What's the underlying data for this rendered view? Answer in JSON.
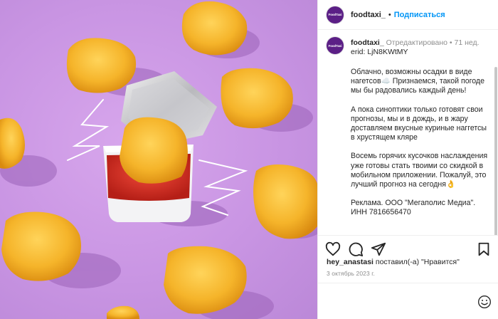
{
  "post": {
    "author": {
      "username": "foodtaxi_",
      "avatar_text": "FoodTaxi"
    },
    "header": {
      "separator": "•",
      "follow_label": "Подписаться"
    },
    "caption": {
      "edited_label": "Отредактировано",
      "dot": "•",
      "age": "71 нед.",
      "erid": "erid: LjN8KWtMY",
      "paragraphs": [
        "Облачно, возможны осадки в виде нагетсов☁️ Признаемся, такой погоде мы бы радовались каждый день!",
        "А пока синоптики только готовят свои прогнозы, мы и в дождь, и в жару доставляем вкусные куриные наггетсы в хрустящем кляре",
        "Восемь горячих кусочков наслаждения уже готовы стать твоими со скидкой в мобильном приложении. Пожалуй, это лучший прогноз на сегодня👌",
        "Реклама. ООО \"Мегаполис Медиа\". ИНН 7816656470"
      ]
    },
    "likes": {
      "user": "hey_anastasi",
      "text": " поставил(-а) \"Нравится\""
    },
    "date": "3 октябрь 2023 г.",
    "icons": [
      "heart-icon",
      "comment-icon",
      "share-icon",
      "bookmark-icon",
      "emoji-icon"
    ],
    "colors": {
      "accent": "#0095f6",
      "background_photo": "#c995e3",
      "avatar_bg": "#5b1f86"
    }
  }
}
